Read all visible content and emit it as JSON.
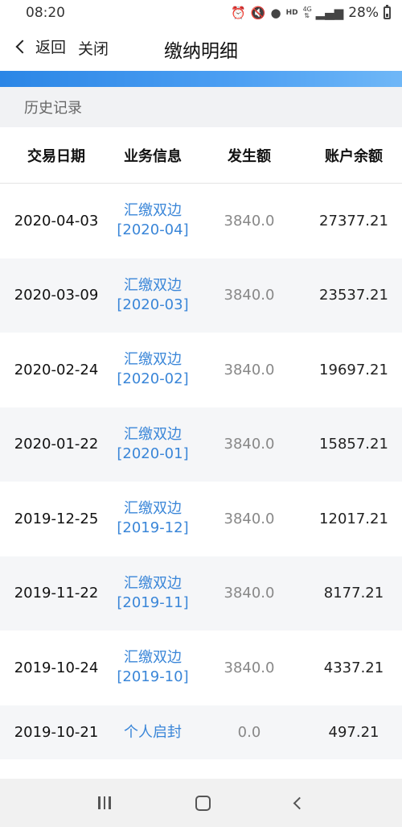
{
  "status_bar": {
    "time": "08:20",
    "battery_percent": "28%",
    "icons": [
      "alarm-icon",
      "mute-icon",
      "location-icon",
      "hd-icon",
      "4g-icon",
      "signal-icon",
      "battery-icon"
    ],
    "hd_label": "HD",
    "network_label": "4G"
  },
  "nav": {
    "back_label": "返回",
    "close_label": "关闭",
    "title": "缴纳明细"
  },
  "section": {
    "title": "历史记录"
  },
  "table": {
    "headers": [
      "交易日期",
      "业务信息",
      "发生额",
      "账户余额"
    ],
    "rows": [
      {
        "date": "2020-04-03",
        "info_line1": "汇缴双边",
        "info_line2": "[2020-04]",
        "amount": "3840.0",
        "balance": "27377.21"
      },
      {
        "date": "2020-03-09",
        "info_line1": "汇缴双边",
        "info_line2": "[2020-03]",
        "amount": "3840.0",
        "balance": "23537.21"
      },
      {
        "date": "2020-02-24",
        "info_line1": "汇缴双边",
        "info_line2": "[2020-02]",
        "amount": "3840.0",
        "balance": "19697.21"
      },
      {
        "date": "2020-01-22",
        "info_line1": "汇缴双边",
        "info_line2": "[2020-01]",
        "amount": "3840.0",
        "balance": "15857.21"
      },
      {
        "date": "2019-12-25",
        "info_line1": "汇缴双边",
        "info_line2": "[2019-12]",
        "amount": "3840.0",
        "balance": "12017.21"
      },
      {
        "date": "2019-11-22",
        "info_line1": "汇缴双边",
        "info_line2": "[2019-11]",
        "amount": "3840.0",
        "balance": "8177.21"
      },
      {
        "date": "2019-10-24",
        "info_line1": "汇缴双边",
        "info_line2": "[2019-10]",
        "amount": "3840.0",
        "balance": "4337.21"
      },
      {
        "date": "2019-10-21",
        "info_line1": "个人启封",
        "info_line2": "",
        "amount": "0.0",
        "balance": "497.21"
      }
    ]
  },
  "colors": {
    "accent": "#3a86d8",
    "progress_start": "#2b86e6",
    "progress_end": "#6fb7f7",
    "section_bg": "#f1f2f4",
    "alt_row_bg": "#f5f6f8"
  },
  "system_nav": {
    "icons": [
      "recent-apps-icon",
      "home-icon",
      "back-icon"
    ]
  }
}
